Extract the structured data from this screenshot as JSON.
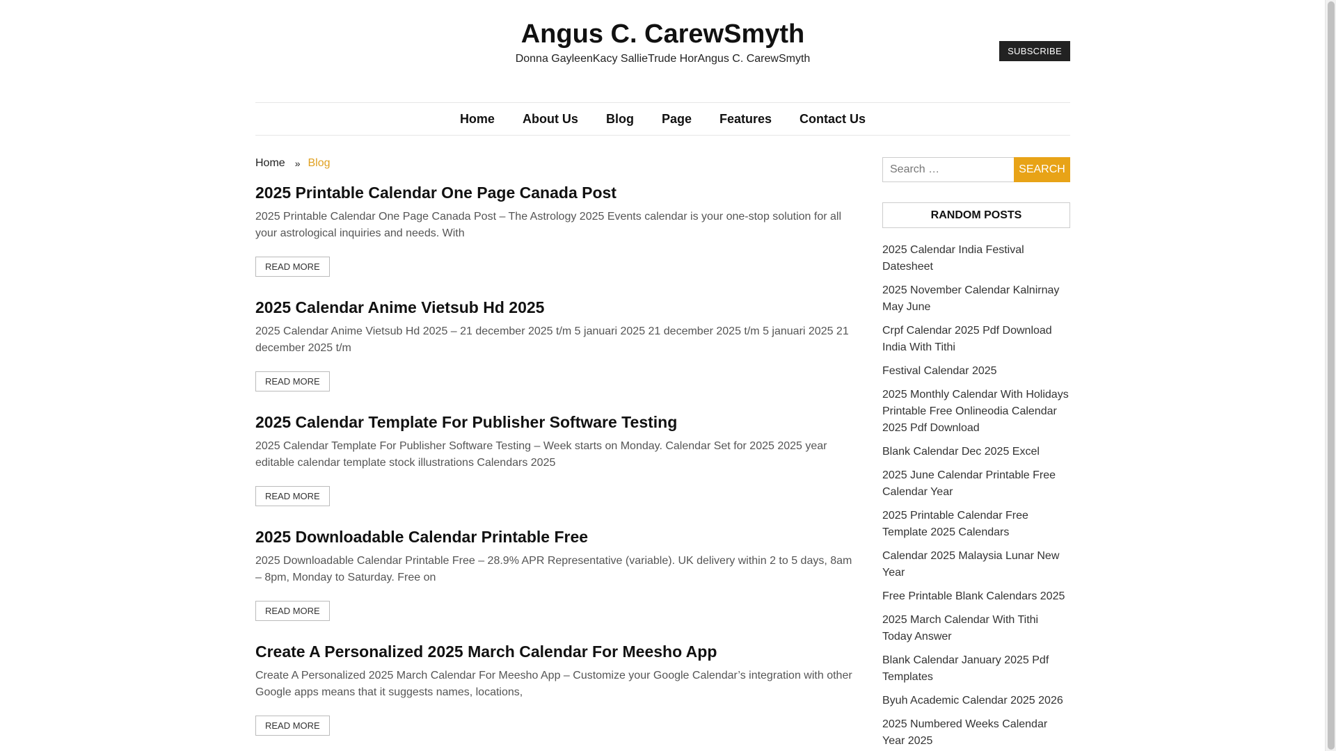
{
  "site": {
    "title": "Angus C. CarewSmyth",
    "description": "Donna GayleenKacy SallieTrude HorAngus C. CarewSmyth",
    "subscribe_label": "SUBSCRIBE"
  },
  "nav": {
    "items": [
      {
        "label": "Home"
      },
      {
        "label": "About Us"
      },
      {
        "label": "Blog"
      },
      {
        "label": "Page"
      },
      {
        "label": "Features"
      },
      {
        "label": "Contact Us"
      }
    ]
  },
  "breadcrumb": {
    "home": "Home",
    "separator": "»",
    "current": "Blog"
  },
  "posts": [
    {
      "title": "2025 Printable Calendar One Page Canada Post",
      "excerpt": "2025 Printable Calendar One Page Canada Post – The Astrology 2025 Events calendar is your one-stop solution for all your astrological inquiries and needs. With",
      "read_more": "READ MORE"
    },
    {
      "title": "2025 Calendar Anime Vietsub Hd 2025",
      "excerpt": "2025 Calendar Anime Vietsub Hd 2025 – 21 december 2025 t/m 5 januari 2025 21 december 2025 t/m 5 januari 2025 21 december 2025 t/m",
      "read_more": "READ MORE"
    },
    {
      "title": "2025 Calendar Template For Publisher Software Testing",
      "excerpt": "2025 Calendar Template For Publisher Software Testing – Week starts on Monday. Calendar Set for 2025 2025 year editable calendar template stock illustrations Calendars 2025",
      "read_more": "READ MORE"
    },
    {
      "title": "2025 Downloadable Calendar Printable Free",
      "excerpt": "2025 Downloadable Calendar Printable Free – 28.9% APR Representative (variable). UK delivery within 2 to 5 days, 8am – 8pm, Monday to Saturday. Free on",
      "read_more": "READ MORE"
    },
    {
      "title": "Create A Personalized 2025 March Calendar For Meesho App",
      "excerpt": "Create A Personalized 2025 March Calendar For Meesho App – Customize your Google Calendar’s integration with other Google apps means that it suggests names, locations,",
      "read_more": "READ MORE"
    }
  ],
  "sidebar": {
    "search_placeholder": "Search …",
    "search_button": "Search",
    "random_title": "RANDOM POSTS",
    "random_posts": [
      "2025 Calendar India Festival Datesheet",
      "2025 November Calendar Kalnirnay May June",
      "Crpf Calendar 2025 Pdf Download India With Tithi",
      "Festival Calendar 2025",
      "2025 Monthly Calendar With Holidays Printable Free Onlineodia Calendar 2025 Pdf Download",
      "Blank Calendar Dec 2025 Excel",
      "2025 June Calendar Printable Free Calendar Year",
      "2025 Printable Calendar Free Template 2025 Calendars",
      "Calendar 2025 Malaysia Lunar New Year",
      "Free Printable Blank Calendars 2025",
      "2025 March Calendar With Tithi Today Answer",
      "Blank Calendar January 2025 Pdf Templates",
      "Byuh Academic Calendar 2025 2026",
      "2025 Numbered Weeks Calendar Year 2025"
    ]
  },
  "colors": {
    "accent": "#e8a317",
    "subscribe_bg": "#222222",
    "text": "#111111"
  }
}
